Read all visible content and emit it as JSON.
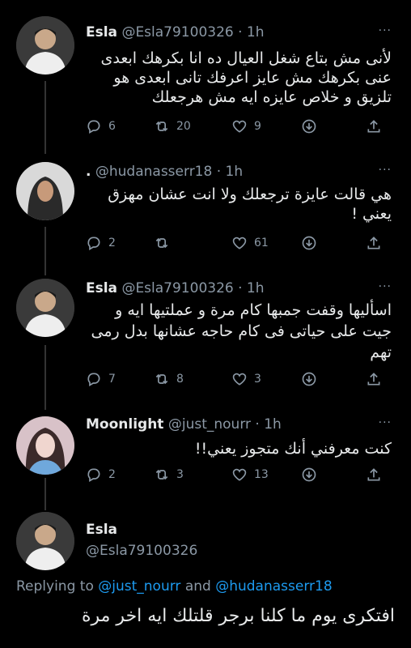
{
  "tweets": [
    {
      "name": "Esla",
      "handle": "@Esla79100326",
      "time": "· 1h",
      "text": "لأنى مش بتاع شغل العيال ده انا بكرهك ابعدى عنى بكرهك مش عايز اعرفك تانى ابعدى هو تلزيق و خلاص عايزه ايه مش هرجعلك",
      "replies": "6",
      "retweets": "20",
      "likes": "9"
    },
    {
      "name": ".",
      "handle": "@hudanasserr18",
      "time": "· 1h",
      "text": "هي قالت عايزة ترجعلك ولا انت عشان مهزق يعني !",
      "replies": "2",
      "retweets": "",
      "likes": "61"
    },
    {
      "name": "Esla",
      "handle": "@Esla79100326",
      "time": "· 1h",
      "text": "اسأليها وقفت جمبها كام مرة و عملتيها ايه و جيت على حياتى فى كام حاجه عشانها بدل رمى تهم",
      "replies": "7",
      "retweets": "8",
      "likes": "3"
    },
    {
      "name": "Moonlight",
      "handle": "@just_nourr",
      "time": "· 1h",
      "text": "كنت معرفني أنك متجوز يعني!!",
      "replies": "2",
      "retweets": "3",
      "likes": "13"
    }
  ],
  "focused": {
    "name": "Esla",
    "handle": "@Esla79100326",
    "replying_prefix": "Replying to",
    "reply_user1": "@just_nourr",
    "reply_and": "and",
    "reply_user2": "@hudanasserr18",
    "text": "افتكرى يوم ما كلنا برجر قلتلك ايه اخر مرة"
  },
  "more_label": "···"
}
